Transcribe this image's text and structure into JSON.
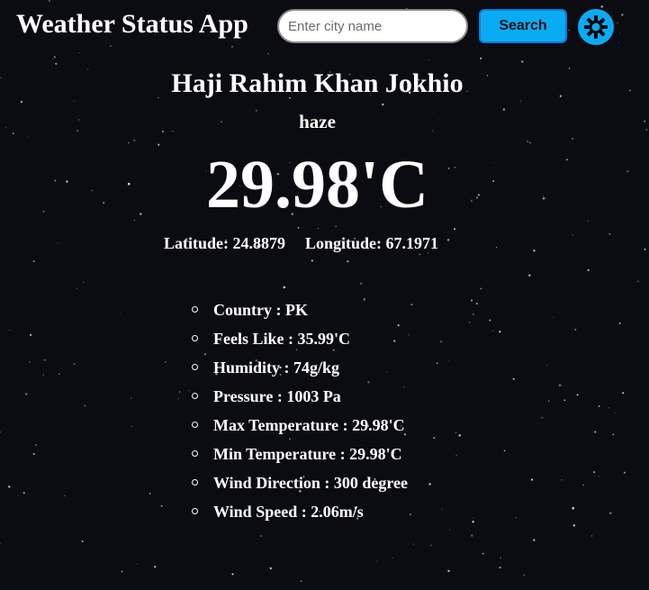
{
  "header": {
    "app_title": "Weather Status App",
    "search_placeholder": "Enter city name",
    "search_value": "",
    "search_label": "Search",
    "theme_icon": "sun-icon"
  },
  "weather": {
    "city": "Haji Rahim Khan Jokhio",
    "condition": "haze",
    "temperature": "29.98'C",
    "latitude_text": "Latitude: 24.8879",
    "longitude_text": "Longitude: 67.1971",
    "details": [
      "Country : PK",
      "Feels Like : 35.99'C",
      "Humidity : 74g/kg",
      "Pressure : 1003 Pa",
      "Max Temperature : 29.98'C",
      "Min Temperature : 29.98'C",
      "Wind Direction : 300 degree",
      "Wind Speed : 2.06m/s"
    ]
  },
  "colors": {
    "background": "#0b0c12",
    "accent": "#0aabf5",
    "text": "#ffffff"
  }
}
